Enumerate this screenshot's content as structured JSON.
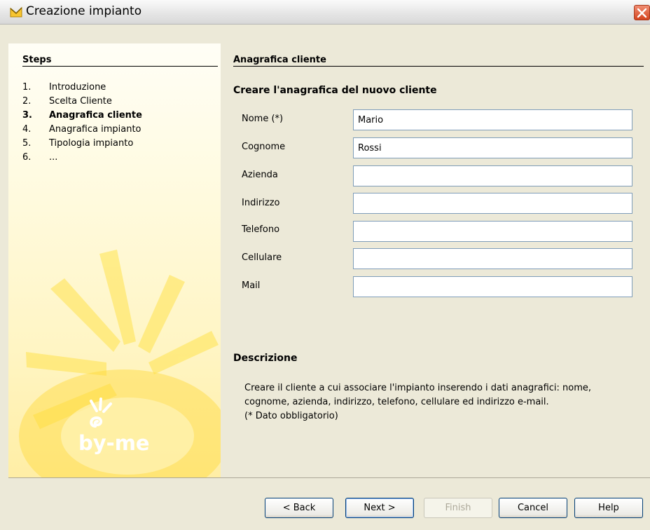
{
  "window": {
    "title": "Creazione impianto",
    "icons": {
      "app": "app-logo-icon",
      "close": "close-icon"
    }
  },
  "steps": {
    "title": "Steps",
    "items": [
      {
        "num": "1.",
        "label": "Introduzione"
      },
      {
        "num": "2.",
        "label": "Scelta Cliente"
      },
      {
        "num": "3.",
        "label": "Anagrafica cliente"
      },
      {
        "num": "4.",
        "label": "Anagrafica impianto"
      },
      {
        "num": "5.",
        "label": "Tipologia impianto"
      },
      {
        "num": "6.",
        "label": "..."
      }
    ],
    "current_index": 2
  },
  "brand": {
    "logo_text": "by-me",
    "icon": "by-me-logo-icon"
  },
  "panel": {
    "title": "Anagrafica cliente",
    "subtitle": "Creare l'anagrafica del nuovo cliente"
  },
  "form": {
    "nome_label": "Nome (*)",
    "nome_value": "Mario",
    "cognome_label": "Cognome",
    "cognome_value": "Rossi",
    "azienda_label": "Azienda",
    "azienda_value": "",
    "indirizzo_label": "Indirizzo",
    "indirizzo_value": "",
    "telefono_label": "Telefono",
    "telefono_value": "",
    "cellulare_label": "Cellulare",
    "cellulare_value": "",
    "mail_label": "Mail",
    "mail_value": ""
  },
  "description": {
    "title": "Descrizione",
    "line1": "Creare il cliente a cui associare l'impianto inserendo i dati anagrafici: nome,",
    "line2": "cognome, azienda, indirizzo, telefono, cellulare ed indirizzo e-mail.",
    "line3": "(* Dato obbligatorio)"
  },
  "buttons": {
    "back": "< Back",
    "next": "Next >",
    "finish": "Finish",
    "cancel": "Cancel",
    "help": "Help"
  },
  "colors": {
    "sun_yellow": "#FFE34D",
    "logo_white": "#FFFFFF",
    "input_border": "#7F9DB9",
    "dialog_bg": "#ECE9D8"
  }
}
